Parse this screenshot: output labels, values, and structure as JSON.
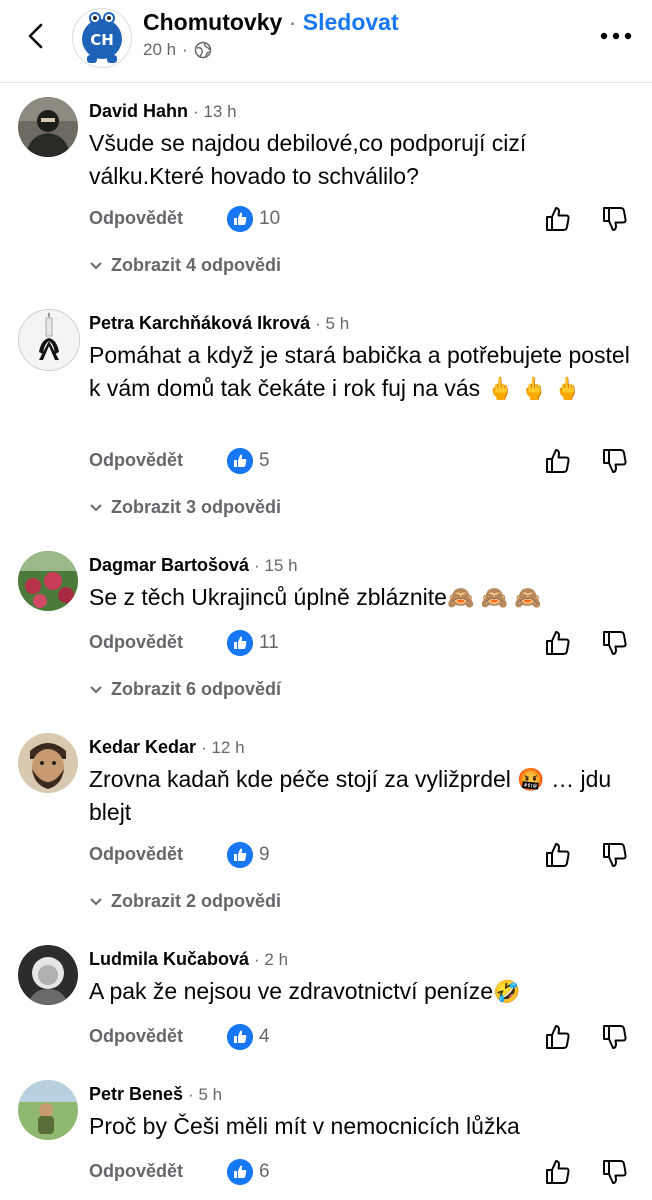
{
  "header": {
    "page_name": "Chomutovky",
    "separator": "·",
    "follow_label": "Sledovat",
    "time": "20 h",
    "back_icon": "chevron-left-icon",
    "privacy_icon": "globe-icon",
    "more_icon": "ellipsis-icon",
    "avatar_text": "CH"
  },
  "comments": [
    {
      "author": "David Hahn",
      "time": "· 13 h",
      "text": "Všude se najdou debilové,co podporují cizí válku.Které hovado to schválilo?",
      "reply_label": "Odpovědět",
      "likes": "10",
      "replies_label": "Zobrazit 4 odpovědi"
    },
    {
      "author": "Petra Karchňáková Ikrová",
      "time": "· 5 h",
      "text": "Pomáhat a když je stará babička a potřebujete postel k vám domů tak čekáte i rok fuj na vás",
      "emoji": "🖕 🖕 🖕",
      "reply_label": "Odpovědět",
      "likes": "5",
      "replies_label": "Zobrazit 3 odpovědi"
    },
    {
      "author": "Dagmar Bartošová",
      "time": "· 15 h",
      "text": "Se z těch Ukrajinců úplně zbláznite",
      "emoji": "🙈 🙈 🙈",
      "reply_label": "Odpovědět",
      "likes": "11",
      "replies_label": "Zobrazit 6 odpovědí"
    },
    {
      "author": "Kedar Kedar",
      "time": "· 12 h",
      "text_a": "Zrovna kadaň kde péče stojí za vyližprdel",
      "emoji": "🤬",
      "text_b": "… jdu blejt",
      "reply_label": "Odpovědět",
      "likes": "9",
      "replies_label": "Zobrazit 2 odpovědi"
    },
    {
      "author": "Ludmila Kučabová",
      "time": "· 2 h",
      "text": "A pak že nejsou ve zdravotnictví peníze",
      "emoji": "🤣",
      "reply_label": "Odpovědět",
      "likes": "4"
    },
    {
      "author": "Petr Beneš",
      "time": "· 5 h",
      "text": "Proč by Češi měli mít v nemocnicích lůžka",
      "reply_label": "Odpovědět",
      "likes": "6"
    }
  ],
  "colors": {
    "accent": "#1877f2",
    "secondary_text": "#65676b"
  }
}
